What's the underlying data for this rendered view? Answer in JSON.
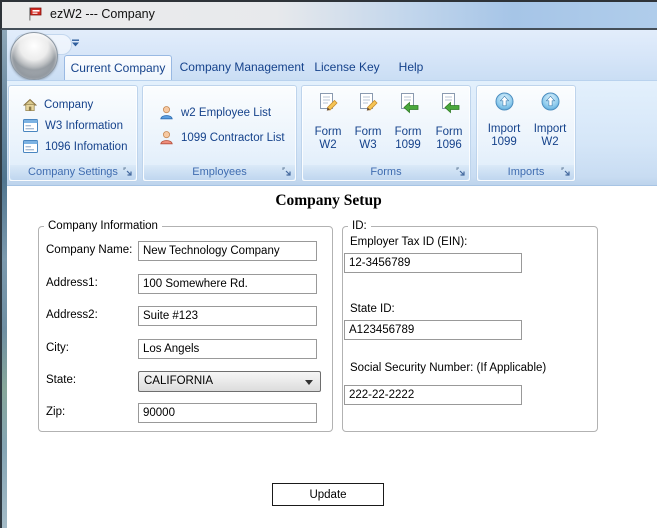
{
  "window": {
    "title": "ezW2 --- Company",
    "icon": "red-flag-icon"
  },
  "tabs": [
    {
      "label": "Current Company",
      "active": true
    },
    {
      "label": "Company Management",
      "active": false
    },
    {
      "label": "License Key",
      "active": false
    },
    {
      "label": "Help",
      "active": false
    }
  ],
  "ribbon": {
    "groups": {
      "company_settings": {
        "caption": "Company Settings",
        "items": [
          {
            "label": "Company",
            "icon": "house-icon"
          },
          {
            "label": "W3 Information",
            "icon": "form-window-icon"
          },
          {
            "label": "1096 Infomation",
            "icon": "form-window-icon"
          }
        ]
      },
      "employees": {
        "caption": "Employees",
        "items": [
          {
            "label": "w2 Employee List",
            "icon": "person-blue-icon"
          },
          {
            "label": "1099 Contractor List",
            "icon": "person-red-icon"
          }
        ]
      },
      "forms": {
        "caption": "Forms",
        "buttons": [
          {
            "line1": "Form",
            "line2": "W2",
            "icon": "form-edit-icon"
          },
          {
            "line1": "Form",
            "line2": "W3",
            "icon": "form-edit-icon"
          },
          {
            "line1": "Form",
            "line2": "1099",
            "icon": "form-export-icon"
          },
          {
            "line1": "Form",
            "line2": "1096",
            "icon": "form-export-icon"
          }
        ]
      },
      "imports": {
        "caption": "Imports",
        "buttons": [
          {
            "line1": "Import",
            "line2": "1099",
            "icon": "import-icon"
          },
          {
            "line1": "Import",
            "line2": "W2",
            "icon": "import-icon"
          }
        ]
      }
    }
  },
  "main": {
    "heading": "Company Setup",
    "company_info": {
      "legend": "Company Information",
      "fields": [
        {
          "label": "Company Name:",
          "value": "New Technology Company",
          "type": "text"
        },
        {
          "label": "Address1:",
          "value": "100 Somewhere Rd.",
          "type": "text"
        },
        {
          "label": "Address2:",
          "value": "Suite #123",
          "type": "text"
        },
        {
          "label": "City:",
          "value": "Los Angels",
          "type": "text"
        },
        {
          "label": "State:",
          "value": "CALIFORNIA",
          "type": "select"
        },
        {
          "label": "Zip:",
          "value": "90000",
          "type": "text"
        }
      ]
    },
    "id_info": {
      "legend": "ID:",
      "fields": [
        {
          "label": "Employer Tax ID (EIN):",
          "value": "12-3456789"
        },
        {
          "label": "State ID:",
          "value": "A123456789"
        },
        {
          "label": "Social Security Number: (If Applicable)",
          "value": "222-22-2222"
        }
      ]
    },
    "update_button": "Update"
  },
  "colors": {
    "ribbon_text": "#15428b",
    "caption_text": "#3f6cb0",
    "glass_blue": "#a6c5e7",
    "flag_red": "#d42a22"
  }
}
